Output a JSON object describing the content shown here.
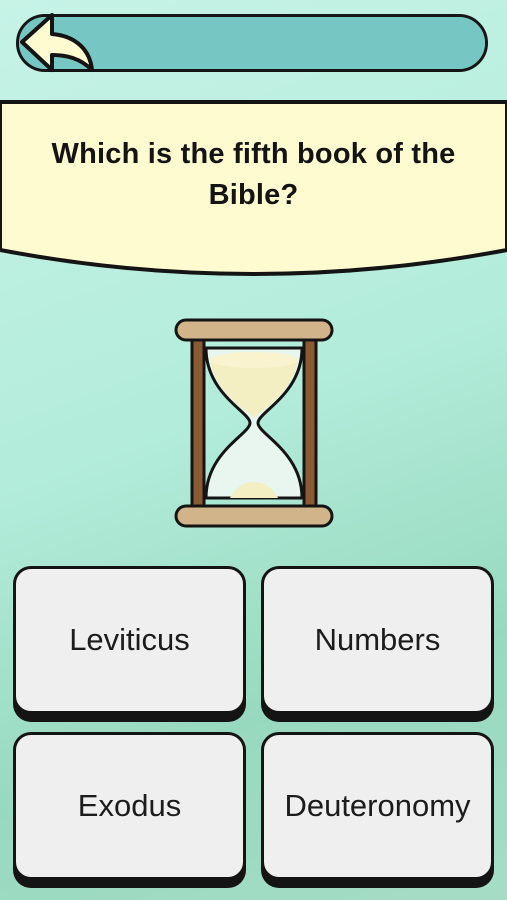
{
  "progress": {
    "fill_fraction": 1.0,
    "color": "#76c7c3"
  },
  "back_button": {
    "icon": "back-arrow-icon"
  },
  "question": {
    "text_line1": "Which is the fifth book of the",
    "text_line2": "Bible?",
    "banner_color": "#fffbd0"
  },
  "timer": {
    "icon": "hourglass-icon"
  },
  "answers": [
    {
      "label": "Leviticus"
    },
    {
      "label": "Numbers"
    },
    {
      "label": "Exodus"
    },
    {
      "label": "Deuteronomy"
    }
  ]
}
